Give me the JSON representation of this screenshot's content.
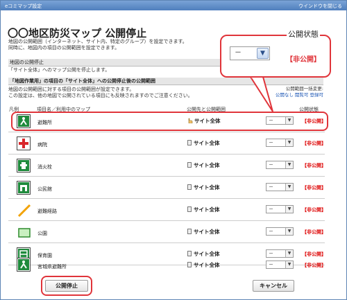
{
  "window": {
    "title": "eコミマップ設定",
    "close_label": "ウインドウを閉じる"
  },
  "page_title": "〇〇地区防災マップ 公開停止",
  "intro": {
    "line1": "地図の公開範囲（インターネット、サイト内、特定のグループ）を設定できます。",
    "line2": "同時に、地図内の項目の公開範囲を設定できます。"
  },
  "section1": {
    "heading": "地図の公開停止",
    "desc": "「サイト全体」へのマップ公開を停止します。"
  },
  "section2": {
    "heading": "「地図作業用」の項目の「サイト全体」への公開停止後の公開範囲",
    "desc1": "地図の公開範囲に対する項目の公開範囲が設定できます。",
    "desc2": "この設定は、他の地図で公開されている項目にも反映されますのでご注意ください。"
  },
  "bulk": {
    "label": "公開範囲一括変更:",
    "links": [
      "公開なし",
      "閲覧可",
      "登録可"
    ]
  },
  "columns": {
    "icon": "凡例",
    "name": "項目名／利用中のマップ",
    "scope": "公開先と公開範囲",
    "status": "公開状態"
  },
  "rows": [
    {
      "name": "避難所",
      "scope": "サイト全体",
      "select": "－",
      "status": "【非公開】",
      "icon": "evacuation-shelter-icon"
    },
    {
      "name": "病院",
      "scope": "サイト全体",
      "select": "－",
      "status": "【非公開】",
      "icon": "hospital-icon"
    },
    {
      "name": "消火栓",
      "scope": "サイト全体",
      "select": "－",
      "status": "【非公開】",
      "icon": "fire-hydrant-icon"
    },
    {
      "name": "公民館",
      "scope": "サイト全体",
      "select": "－",
      "status": "【非公開】",
      "icon": "community-hall-icon"
    },
    {
      "name": "避難経路",
      "scope": "サイト全体",
      "select": "－",
      "status": "【非公開】",
      "icon": "evacuation-route-icon"
    },
    {
      "name": "公園",
      "scope": "サイト全体",
      "select": "－",
      "status": "【非公開】",
      "icon": "park-icon"
    },
    {
      "name": "保育園",
      "scope": "サイト全体",
      "select": "－",
      "status": "【非公開】",
      "icon": "nursery-icon"
    },
    {
      "name": "宮城県避難所",
      "scope": "サイト全体",
      "select": "－",
      "status": "【非公開】",
      "icon": "miyagi-shelter-icon"
    }
  ],
  "callout": {
    "title": "公開状態",
    "select": "－",
    "status": "【非公開】"
  },
  "buttons": {
    "stop": "公開停止",
    "cancel": "キャンセル"
  },
  "colors": {
    "highlight": "#e0343a",
    "status": "#dd0000",
    "link": "#1a55b5",
    "titlebar": "#4f7fbd"
  }
}
